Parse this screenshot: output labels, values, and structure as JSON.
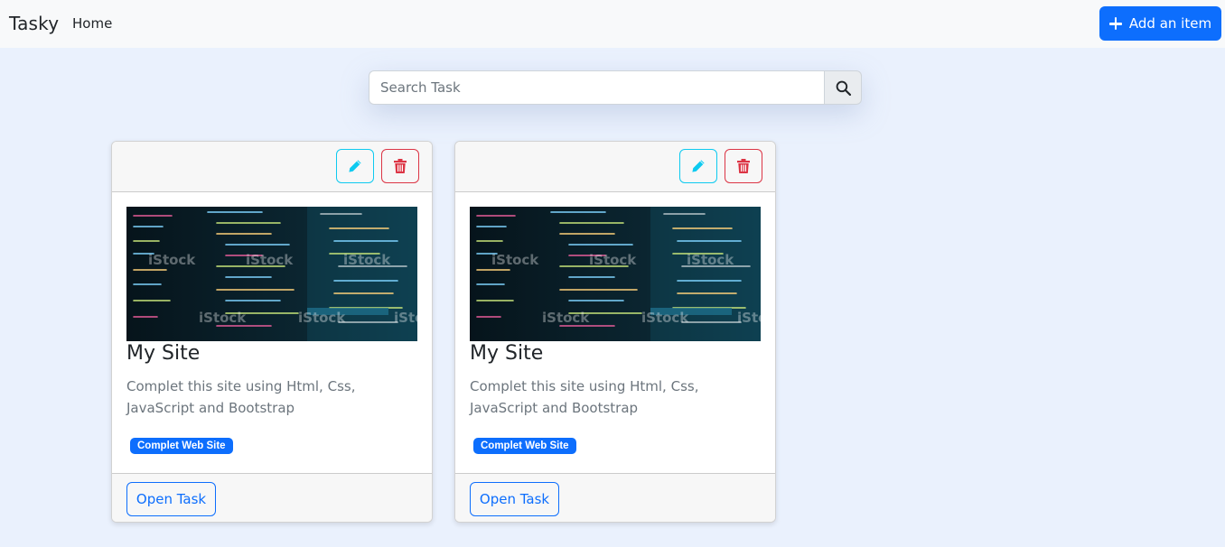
{
  "navbar": {
    "brand": "Tasky",
    "home_label": "Home",
    "add_button_label": "Add an item"
  },
  "search": {
    "placeholder": "Search Task",
    "value": ""
  },
  "cards": [
    {
      "image_watermark": "iStock",
      "title": "My Site",
      "description": "Complet this site using Html, Css, JavaScript and Bootstrap",
      "badge": "Complet Web Site",
      "open_label": "Open Task"
    },
    {
      "image_watermark": "iStock",
      "title": "My Site",
      "description": "Complet this site using Html, Css, JavaScript and Bootstrap",
      "badge": "Complet Web Site",
      "open_label": "Open Task"
    }
  ],
  "colors": {
    "primary": "#0d6efd",
    "info": "#0dcaf0",
    "danger": "#dc3545",
    "page_bg": "#eaf1fd"
  },
  "icons": {
    "search": "search-icon",
    "edit": "pencil-icon",
    "delete": "trash-icon",
    "add": "plus-icon"
  }
}
